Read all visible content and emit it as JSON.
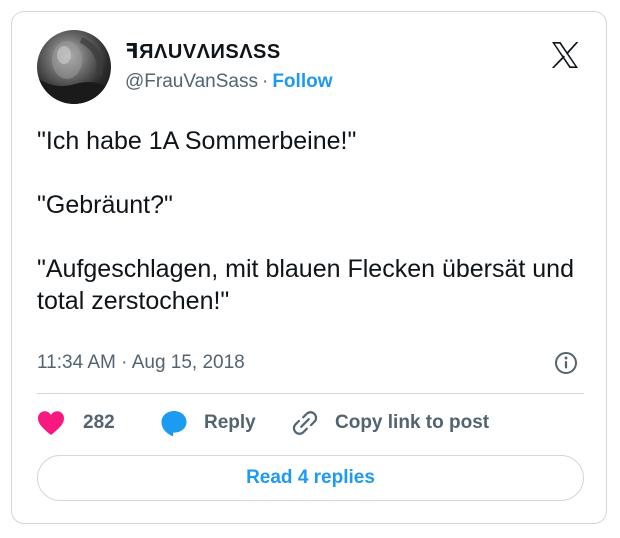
{
  "author": {
    "display_name": "ꟻЯΛUVΛИSΛSS",
    "handle": "@FrauVanSass",
    "separator": "·",
    "follow_label": "Follow",
    "avatar_icon": "profile-photo"
  },
  "tweet": {
    "paragraphs": [
      "\"Ich habe 1A Sommerbeine!\"",
      "\"Gebräunt?\"",
      "\"Aufgeschlagen, mit blauen Flecken übersät und total zerstochen!\""
    ],
    "timestamp": "11:34 AM · Aug 15, 2018"
  },
  "actions": {
    "like_count": "282",
    "reply_label": "Reply",
    "copy_label": "Copy link to post"
  },
  "read_replies_label": "Read 4 replies",
  "icons": {
    "brand": "x-logo-icon",
    "info": "info-icon",
    "like": "heart-icon",
    "reply": "speech-bubble-icon",
    "copy": "link-icon"
  },
  "colors": {
    "accent": "#1d9bf0",
    "heart": "#f91880",
    "text": "#0f1419",
    "muted": "#536471",
    "border": "#cfd9de"
  }
}
